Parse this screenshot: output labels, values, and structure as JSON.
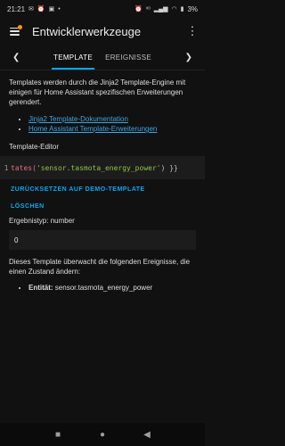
{
  "status_bar": {
    "time": "21:21",
    "left_icons": [
      "mail-icon",
      "alarm-icon",
      "gallery-icon",
      "dot-icon"
    ],
    "right_icons": [
      "alarm-icon",
      "volte-icon",
      "signal-icon",
      "wifi-icon"
    ],
    "battery": "3%"
  },
  "app_bar": {
    "title": "Entwicklerwerkzeuge"
  },
  "tabs": [
    {
      "label": "TEMPLATE",
      "active": true
    },
    {
      "label": "EREIGNISSE",
      "active": false
    }
  ],
  "intro_text": "Templates werden durch die Jinja2 Template-Engine mit einigen für Home Assistant spezifischen Erweiterungen gerendert.",
  "links": [
    "Jinja2 Template-Dokumentation",
    "Home Assistant Template-Erweiterungen"
  ],
  "editor": {
    "label": "Template-Editor",
    "line_number": "1",
    "code_fn": "tates(",
    "code_str": "'sensor.tasmota_energy_power'",
    "code_end": ") }}"
  },
  "buttons": {
    "reset": "ZURÜCKSETZEN AUF DEMO-TEMPLATE",
    "clear": "LÖSCHEN"
  },
  "result": {
    "type_text": "Ergebnistyp: number",
    "value": "0"
  },
  "monitoring_text": "Dieses Template überwacht die folgenden Ereignisse, die einen Zustand ändern:",
  "entity": {
    "label": "Entität:",
    "value": "sensor.tasmota_energy_power"
  },
  "colors": {
    "background": "#111111",
    "accent": "#03a9f4",
    "link": "#3aa6e6",
    "badge": "#ff9800"
  }
}
